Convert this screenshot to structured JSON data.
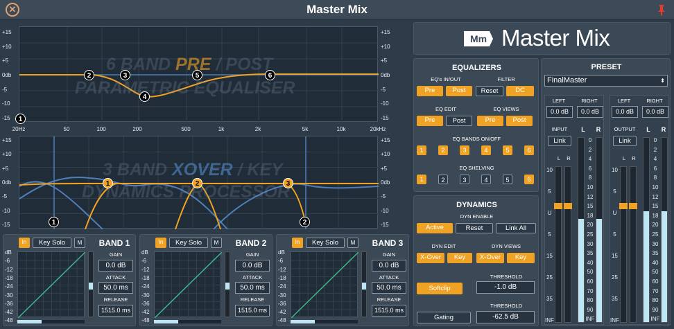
{
  "app": {
    "title": "Master Mix",
    "brand_badge": "Mm",
    "brand": "Master Mix"
  },
  "eq_graph": {
    "db_ticks": [
      "+15",
      "+10",
      "+5",
      "0db",
      "-5",
      "-10",
      "-15"
    ],
    "freq_ticks": [
      "20Hz",
      "50",
      "100",
      "200",
      "500",
      "1k",
      "2k",
      "5k",
      "10k",
      "20kHz"
    ],
    "watermark1": "6 BAND",
    "watermark_pre": "PRE",
    "watermark_post": "/ POST",
    "watermark2": "PARAMETRIC EQUALISER",
    "nodes": [
      "1",
      "2",
      "3",
      "4",
      "5",
      "6"
    ]
  },
  "xover_graph": {
    "db_ticks": [
      "+15",
      "+10",
      "+5",
      "0db",
      "-5",
      "-10",
      "-15"
    ],
    "watermark1": "3 BAND",
    "watermark_xover": "XOVER",
    "watermark_key": "/ KEY",
    "watermark2": "DYNAMICS PROCESSOR",
    "orange_nodes": [
      "1",
      "2",
      "3"
    ],
    "blue_nodes": [
      "1",
      "2"
    ]
  },
  "bands": [
    {
      "title": "BAND 1",
      "in": "In",
      "key_solo": "Key Solo",
      "m": "M",
      "gain_label": "GAIN",
      "gain": "0.0 dB",
      "attack_label": "ATTACK",
      "attack": "50.0 ms",
      "release_label": "RELEASE",
      "release": "1515.0 ms",
      "scale": [
        "dB",
        "-6",
        "-12",
        "-18",
        "-24",
        "-30",
        "-36",
        "-42",
        "-48"
      ]
    },
    {
      "title": "BAND 2",
      "in": "In",
      "key_solo": "Key Solo",
      "m": "M",
      "gain_label": "GAIN",
      "gain": "0.0 dB",
      "attack_label": "ATTACK",
      "attack": "50.0 ms",
      "release_label": "RELEASE",
      "release": "1515.0 ms",
      "scale": [
        "dB",
        "-6",
        "-12",
        "-18",
        "-24",
        "-30",
        "-36",
        "-42",
        "-48"
      ]
    },
    {
      "title": "BAND 3",
      "in": "In",
      "key_solo": "Key Solo",
      "m": "M",
      "gain_label": "GAIN",
      "gain": "0.0 dB",
      "attack_label": "ATTACK",
      "attack": "50.0 ms",
      "release_label": "RELEASE",
      "release": "1515.0 ms",
      "scale": [
        "dB",
        "-6",
        "-12",
        "-18",
        "-24",
        "-30",
        "-36",
        "-42",
        "-48"
      ]
    }
  ],
  "equalizers": {
    "title": "EQUALIZERS",
    "eqs_inout_label": "EQ's IN/OUT",
    "filter_label": "FILTER",
    "pre": "Pre",
    "post": "Post",
    "reset": "Reset",
    "dc": "DC",
    "eq_edit_label": "EQ EDIT",
    "eq_views_label": "EQ VIEWS",
    "eq_bands_label": "EQ BANDS ON/OFF",
    "eq_shelving_label": "EQ SHELVING",
    "bands": [
      "1",
      "2",
      "3",
      "4",
      "5",
      "6"
    ]
  },
  "dynamics": {
    "title": "DYNAMICS",
    "dyn_enable_label": "DYN ENABLE",
    "active": "Active",
    "reset": "Reset",
    "link_all": "Link All",
    "dyn_edit_label": "DYN EDIT",
    "dyn_views_label": "DYN VIEWS",
    "xover": "X-Over",
    "key": "Key",
    "softclip": "Softclip",
    "threshold_label": "THRESHOLD",
    "softclip_threshold": "-1.0 dB",
    "gating": "Gating",
    "gating_threshold": "-62.5 dB"
  },
  "preset": {
    "title": "PRESET",
    "selected": "FinalMaster"
  },
  "input": {
    "left_label": "LEFT",
    "right_label": "RIGHT",
    "left": "0.0 dB",
    "right": "0.0 dB",
    "label": "INPUT",
    "link": "Link",
    "l": "L",
    "r": "R",
    "fader_scale": [
      "10",
      "5",
      "U",
      "5",
      "15",
      "25",
      "35",
      "INF"
    ],
    "meter_scale": [
      "0",
      "2",
      "4",
      "6",
      "8",
      "10",
      "12",
      "15",
      "18",
      "20",
      "25",
      "30",
      "35",
      "40",
      "50",
      "60",
      "70",
      "80",
      "90",
      "INF"
    ]
  },
  "output": {
    "left_label": "LEFT",
    "right_label": "RIGHT",
    "left": "0.0 dB",
    "right": "0.0 dB",
    "label": "OUTPUT",
    "link": "Link",
    "l": "L",
    "r": "R",
    "fader_scale": [
      "10",
      "5",
      "U",
      "5",
      "15",
      "25",
      "35",
      "INF"
    ],
    "meter_scale": [
      "0",
      "2",
      "4",
      "6",
      "8",
      "10",
      "12",
      "15",
      "18",
      "20",
      "25",
      "30",
      "35",
      "40",
      "50",
      "60",
      "70",
      "80",
      "90",
      "INF"
    ]
  },
  "meters": {
    "input_left_level": 0.56,
    "input_right_level": 0.56,
    "output_left_level": 0.6,
    "output_right_level": 0.6
  }
}
